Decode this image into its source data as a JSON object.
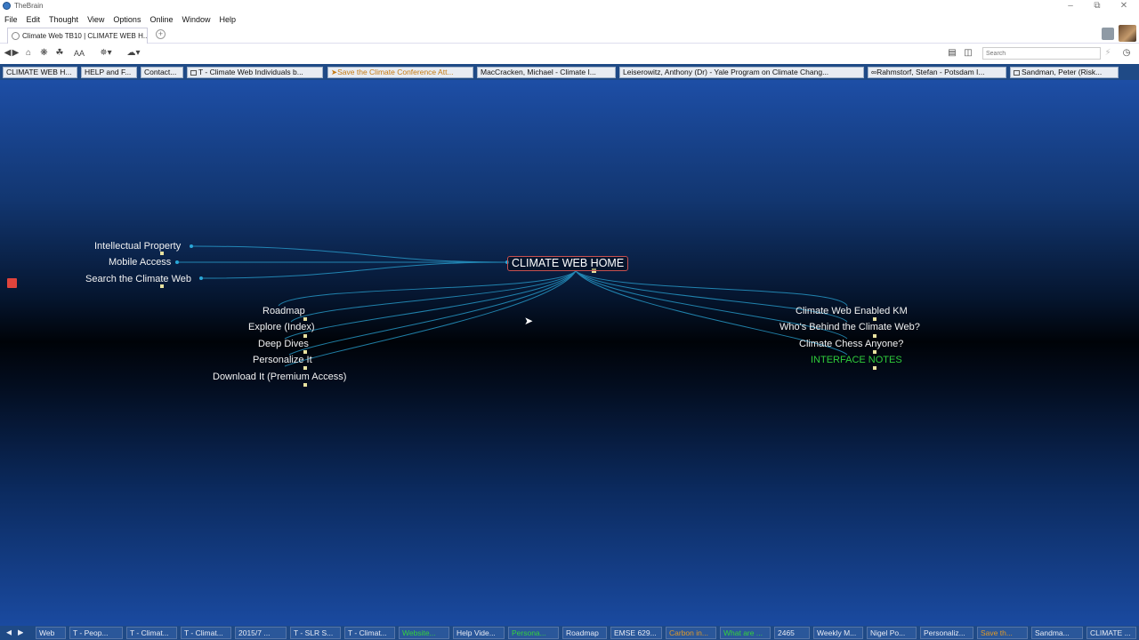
{
  "window": {
    "title": "TheBrain"
  },
  "menu": [
    "File",
    "Edit",
    "Thought",
    "View",
    "Options",
    "Online",
    "Window",
    "Help"
  ],
  "tab": {
    "label": "Climate Web TB10 | CLIMATE WEB H..."
  },
  "toolbar": {
    "search_placeholder": "Search"
  },
  "pins": [
    {
      "label": "CLIMATE WEB H...",
      "style": "normal"
    },
    {
      "label": "HELP and F...",
      "style": "normal"
    },
    {
      "label": "Contact...",
      "style": "normal"
    },
    {
      "label": "T - Climate Web Individuals b...",
      "style": "normal"
    },
    {
      "label": "Save the Climate Conference Att...",
      "style": "orange"
    },
    {
      "label": "MacCracken, Michael - Climate I...",
      "style": "normal"
    },
    {
      "label": "Leiserowitz, Anthony (Dr) - Yale Program on Climate Chang...",
      "style": "normal"
    },
    {
      "label": "Rahmstorf, Stefan - Potsdam I...",
      "style": "normal"
    },
    {
      "label": "Sandman, Peter  (Risk...",
      "style": "normal"
    }
  ],
  "plex": {
    "central": "CLIMATE WEB HOME",
    "parents": [
      "Intellectual Property",
      "Mobile Access",
      "Search the Climate Web"
    ],
    "children_left": [
      "Roadmap",
      "Explore (Index)",
      "Deep Dives",
      "Personalize It",
      "Download It (Premium Access)"
    ],
    "children_right": [
      "Climate Web Enabled KM",
      "Who's Behind the Climate Web?",
      "Climate Chess Anyone?",
      "INTERFACE NOTES"
    ],
    "link_color": "#2aa7d8",
    "accent_green": "#2fcc3a"
  },
  "bottom_tabs": [
    {
      "label": "Web",
      "style": "normal"
    },
    {
      "label": "T - Peop...",
      "style": "normal"
    },
    {
      "label": "T - Climat...",
      "style": "normal"
    },
    {
      "label": "T - Climat...",
      "style": "normal"
    },
    {
      "label": "2015/7 ...",
      "style": "normal"
    },
    {
      "label": "T - SLR S...",
      "style": "normal"
    },
    {
      "label": "T - Climat...",
      "style": "normal"
    },
    {
      "label": "Website...",
      "style": "green"
    },
    {
      "label": "Help Vide...",
      "style": "normal"
    },
    {
      "label": "Persona...",
      "style": "green"
    },
    {
      "label": "Roadmap",
      "style": "normal"
    },
    {
      "label": "EMSE 629...",
      "style": "normal"
    },
    {
      "label": "Carbon in...",
      "style": "orange"
    },
    {
      "label": "What are ...",
      "style": "green"
    },
    {
      "label": "2465",
      "style": "normal"
    },
    {
      "label": "Weekly M...",
      "style": "normal"
    },
    {
      "label": "Nigel Po...",
      "style": "normal"
    },
    {
      "label": "Personaliz...",
      "style": "normal"
    },
    {
      "label": "Save th...",
      "style": "orange"
    },
    {
      "label": "Sandma...",
      "style": "normal"
    },
    {
      "label": "CLIMATE ...",
      "style": "normal"
    }
  ]
}
